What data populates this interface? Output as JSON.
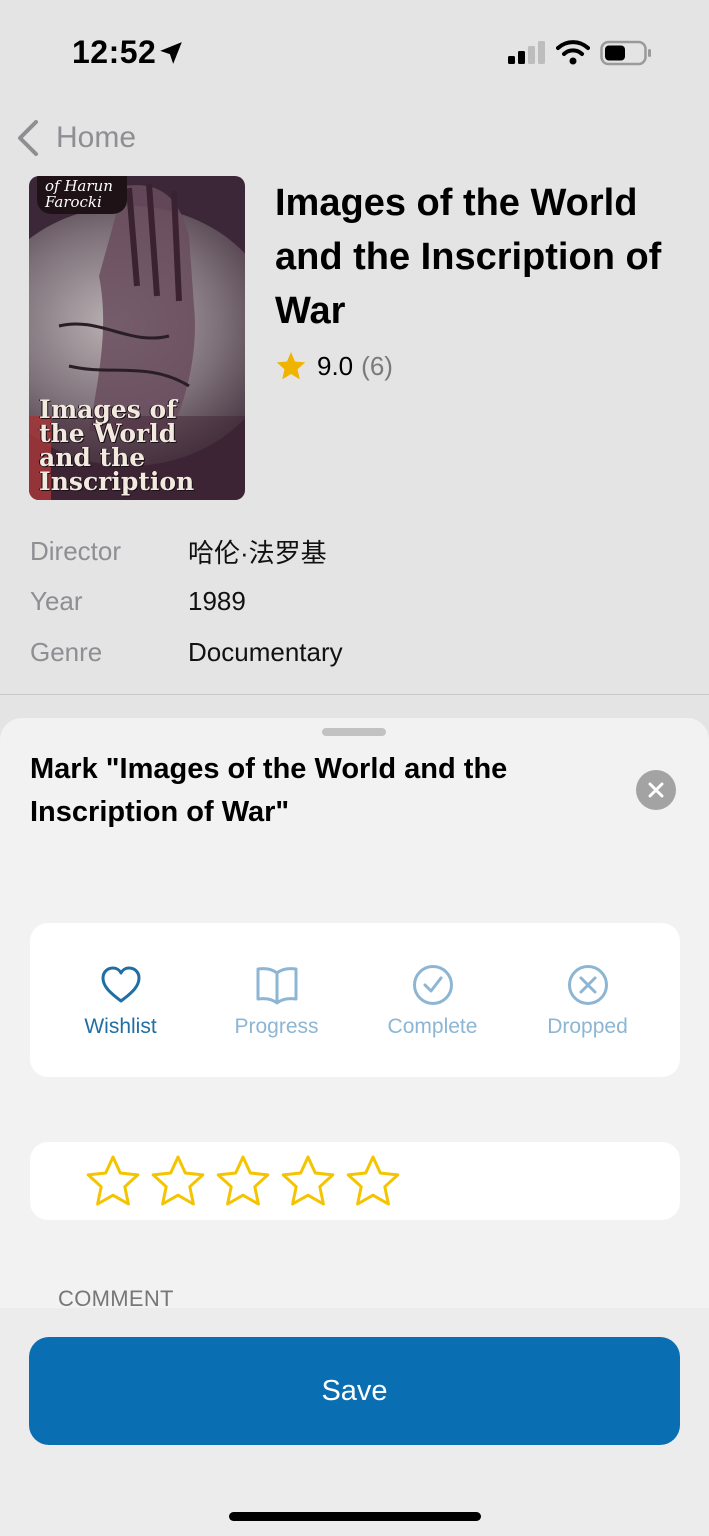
{
  "status_bar": {
    "time": "12:52"
  },
  "nav": {
    "back_label": "Home"
  },
  "item": {
    "poster_tag": "of Harun\nFarocki",
    "poster_text": "Images of\nthe World\nand the\nInscription",
    "title": "Images of the World and the Inscription of War",
    "rating": "9.0",
    "rating_count": "(6)",
    "details": [
      {
        "key": "Director",
        "value": "哈伦·法罗基"
      },
      {
        "key": "Year",
        "value": "1989"
      },
      {
        "key": "Genre",
        "value": "Documentary"
      }
    ]
  },
  "sheet": {
    "title": "Mark \"Images of the World and the Inscription of War\"",
    "statuses": [
      {
        "label": "Wishlist",
        "icon": "heart-icon",
        "active": true
      },
      {
        "label": "Progress",
        "icon": "book-icon",
        "active": false
      },
      {
        "label": "Complete",
        "icon": "check-circle-icon",
        "active": false
      },
      {
        "label": "Dropped",
        "icon": "x-circle-icon",
        "active": false
      }
    ],
    "user_rating": {
      "selected": 0,
      "max": 5
    },
    "comment_label": "COMMENT",
    "save_label": "Save"
  },
  "colors": {
    "accent": "#0a6eb2",
    "active_status": "#1f6fa5",
    "inactive_status": "#8cb6d3",
    "star_gold": "#f5c400",
    "rating_star": "#f0b400"
  }
}
